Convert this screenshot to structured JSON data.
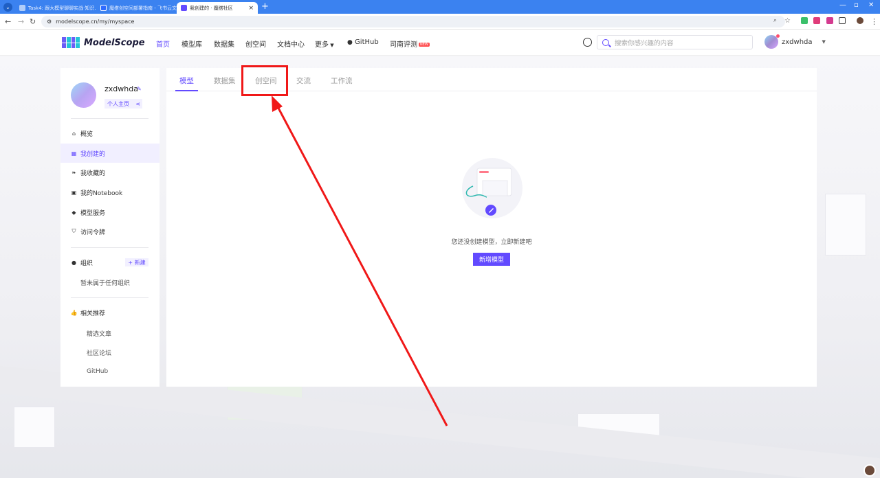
{
  "browser": {
    "tabs": [
      {
        "title": "Task4: 跟大模型聊聊实战·知识...",
        "active": false
      },
      {
        "title": "魔搭创空间部署指南 - 飞书云文...",
        "active": false
      },
      {
        "title": "我创建的 · 魔搭社区",
        "active": true
      }
    ],
    "url": "modelscope.cn/my/myspace"
  },
  "header": {
    "logo_text": "ModelScope",
    "nav": [
      "首页",
      "模型库",
      "数据集",
      "创空间",
      "文档中心",
      "更多",
      "GitHub",
      "司南评测"
    ],
    "active_nav": "首页",
    "new_badge": "NEW",
    "search_placeholder": "搜索你感兴趣的内容",
    "username": "zxdwhda"
  },
  "sidebar": {
    "username": "zxdwhda",
    "homepage_label": "个人主页",
    "items": [
      {
        "label": "概览",
        "icon": "home-icon"
      },
      {
        "label": "我创建的",
        "icon": "grid-icon",
        "active": true
      },
      {
        "label": "我收藏的",
        "icon": "leaf-icon"
      },
      {
        "label": "我的Notebook",
        "icon": "notebook-icon"
      },
      {
        "label": "模型服务",
        "icon": "cube-icon"
      },
      {
        "label": "访问令牌",
        "icon": "shield-icon"
      }
    ],
    "org_label": "组织",
    "new_label": "新建",
    "org_empty": "暂未属于任何组织",
    "related_label": "相关推荐",
    "related_items": [
      "精选文章",
      "社区论坛",
      "GitHub"
    ]
  },
  "main": {
    "tabs": [
      "模型",
      "数据集",
      "创空间",
      "交流",
      "工作流"
    ],
    "active_tab": "模型",
    "empty_text": "您还没创建模型，立即新建吧",
    "create_button": "新增模型"
  },
  "colors": {
    "accent": "#624aff",
    "annotation": "#f01818"
  }
}
